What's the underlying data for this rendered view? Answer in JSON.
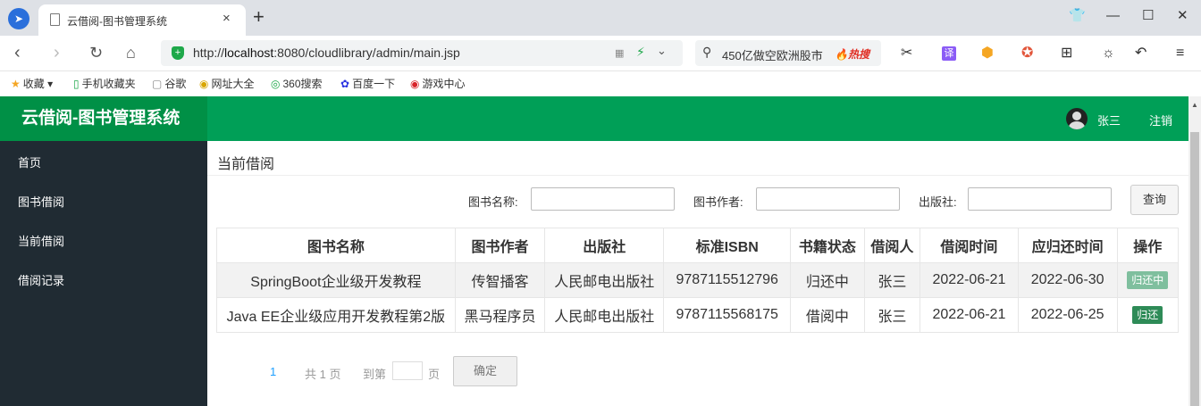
{
  "browser": {
    "tab_title": "云借阅-图书管理系统",
    "close_glyph": "×",
    "new_tab_glyph": "+",
    "url_host": "localhost",
    "url_prefix": "http://",
    "url_rest": ":8080/cloudlibrary/admin/main.jsp",
    "search_text": "450亿做空欧洲股市",
    "search_hot": "🔥热搜",
    "translate_label": "译"
  },
  "bookmarks": [
    {
      "icon": "★",
      "label": "收藏"
    },
    {
      "icon": "▯",
      "label": "手机收藏夹"
    },
    {
      "icon": "▢",
      "label": "谷歌"
    },
    {
      "icon": "◉",
      "label": "网址大全"
    },
    {
      "icon": "◎",
      "label": "360搜索"
    },
    {
      "icon": "✿",
      "label": "百度一下"
    },
    {
      "icon": "◉",
      "label": "游戏中心"
    }
  ],
  "app": {
    "title": "云借阅-图书管理系统",
    "user_name": "张三",
    "logout": "注销",
    "sidebar": [
      "首页",
      "图书借阅",
      "当前借阅",
      "借阅记录"
    ],
    "breadcrumb": "当前借阅"
  },
  "filters": {
    "book_name_label": "图书名称:",
    "book_author_label": "图书作者:",
    "publisher_label": "出版社:",
    "book_name_value": "",
    "book_author_value": "",
    "publisher_value": "",
    "query_button": "查询"
  },
  "table": {
    "headers": [
      "图书名称",
      "图书作者",
      "出版社",
      "标准ISBN",
      "书籍状态",
      "借阅人",
      "借阅时间",
      "应归还时间",
      "操作"
    ],
    "rows": [
      {
        "name": "SpringBoot企业级开发教程",
        "author": "传智播客",
        "publisher": "人民邮电出版社",
        "isbn": "9787115512796",
        "status": "归还中",
        "borrower": "张三",
        "borrow_time": "2022-06-21",
        "return_time": "2022-06-30",
        "action": "归还中",
        "action_color": "#7fbf9e"
      },
      {
        "name": "Java EE企业级应用开发教程第2版",
        "author": "黑马程序员",
        "publisher": "人民邮电出版社",
        "isbn": "9787115568175",
        "status": "借阅中",
        "borrower": "张三",
        "borrow_time": "2022-06-21",
        "return_time": "2022-06-25",
        "action": "归还",
        "action_color": "#2e8b57"
      }
    ]
  },
  "pagination": {
    "current_page": "1",
    "total": "共 1 页",
    "goto_prefix": "到第",
    "goto_suffix": "页",
    "goto_value": "",
    "confirm": "确定"
  },
  "colors": {
    "header_green": "#009f57",
    "logo_green": "#009046",
    "sidebar_dark": "#202b33"
  }
}
